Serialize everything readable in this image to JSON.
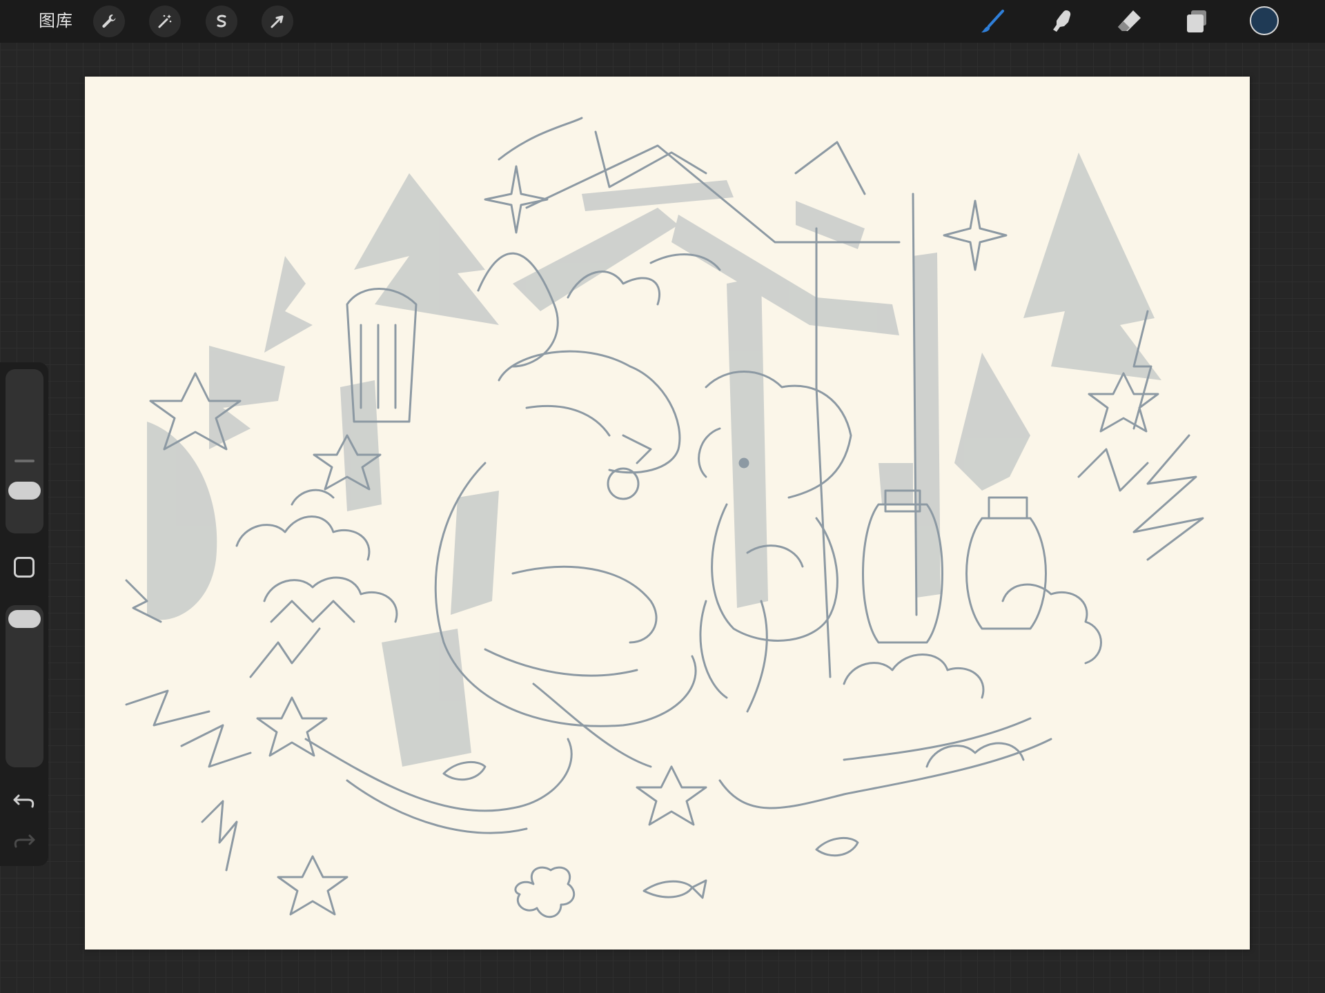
{
  "topbar": {
    "gallery_label": "图库",
    "left_tools": [
      {
        "name": "actions",
        "icon": "wrench-icon"
      },
      {
        "name": "adjustments",
        "icon": "magic-wand-icon"
      },
      {
        "name": "selection",
        "icon": "selection-s-icon"
      },
      {
        "name": "transform",
        "icon": "arrow-cursor-icon"
      }
    ],
    "right_tools": [
      {
        "name": "brush",
        "icon": "brush-icon",
        "active": true
      },
      {
        "name": "smudge",
        "icon": "smudge-finger-icon",
        "active": false
      },
      {
        "name": "eraser",
        "icon": "eraser-icon",
        "active": false
      },
      {
        "name": "layers",
        "icon": "layers-icon",
        "active": false
      }
    ],
    "current_color": "#1f3a55",
    "active_tool_color": "#2f7fd9"
  },
  "canvas": {
    "paper_color": "#fbf6e9",
    "ink_color": "#8c99a3"
  },
  "sidebar": {
    "brush_size_icon": "size-slider",
    "opacity_icon": "opacity-slider",
    "modify_icon": "square-modify-icon",
    "undo_icon": "undo-arrow-icon",
    "redo_icon": "redo-arrow-icon"
  }
}
